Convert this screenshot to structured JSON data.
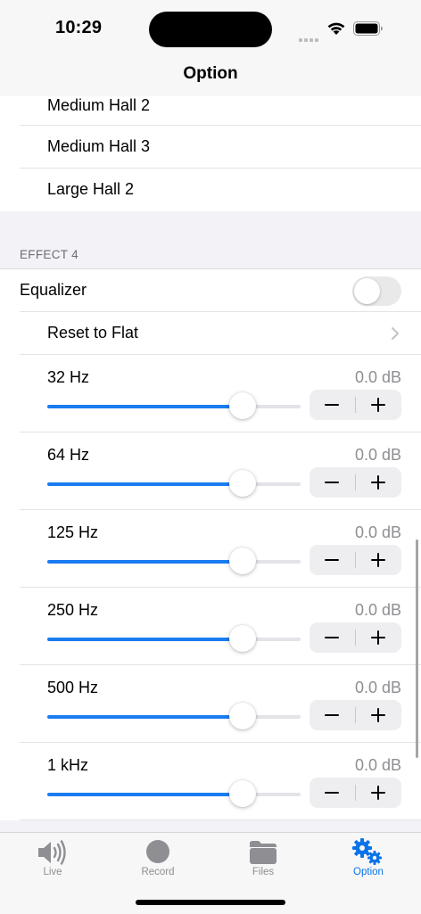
{
  "status": {
    "time": "10:29"
  },
  "nav": {
    "title": "Option"
  },
  "reverb_list": [
    "Medium Hall 2",
    "Medium Hall 3",
    "Large Hall 2"
  ],
  "effect4": {
    "header": "EFFECT 4",
    "equalizer_label": "Equalizer",
    "equalizer_on": false,
    "reset_label": "Reset to Flat",
    "bands": [
      {
        "label": "32 Hz",
        "value": "0.0 dB",
        "level": 0.77
      },
      {
        "label": "64 Hz",
        "value": "0.0 dB",
        "level": 0.77
      },
      {
        "label": "125 Hz",
        "value": "0.0 dB",
        "level": 0.77
      },
      {
        "label": "250 Hz",
        "value": "0.0 dB",
        "level": 0.77
      },
      {
        "label": "500 Hz",
        "value": "0.0 dB",
        "level": 0.77
      },
      {
        "label": "1 kHz",
        "value": "0.0 dB",
        "level": 0.77
      }
    ]
  },
  "tabs": [
    {
      "label": "Live",
      "icon": "speaker-icon",
      "active": false
    },
    {
      "label": "Record",
      "icon": "record-icon",
      "active": false
    },
    {
      "label": "Files",
      "icon": "folder-icon",
      "active": false
    },
    {
      "label": "Option",
      "icon": "gears-icon",
      "active": true
    }
  ],
  "colors": {
    "accent": "#1a7cf0",
    "tab_active": "#0a73ea",
    "tab_inactive": "#8e8e93"
  }
}
